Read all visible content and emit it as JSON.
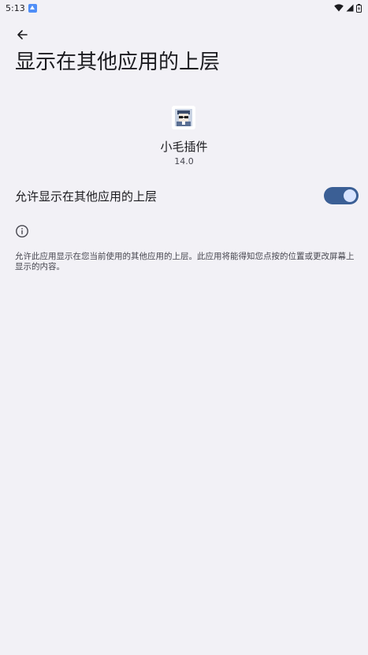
{
  "status_bar": {
    "time": "5:13",
    "icons": [
      "app-notification-icon",
      "wifi-icon",
      "signal-icon",
      "battery-icon"
    ]
  },
  "header": {
    "title": "显示在其他应用的上层"
  },
  "app": {
    "name": "小毛插件",
    "version": "14.0",
    "icon": "app-avatar-icon"
  },
  "permission": {
    "label": "允许显示在其他应用的上层",
    "enabled": true,
    "accent": "#3b5f95"
  },
  "info": {
    "icon": "info-icon",
    "text": "允许此应用显示在您当前使用的其他应用的上层。此应用将能得知您点按的位置或更改屏幕上显示的内容。"
  }
}
